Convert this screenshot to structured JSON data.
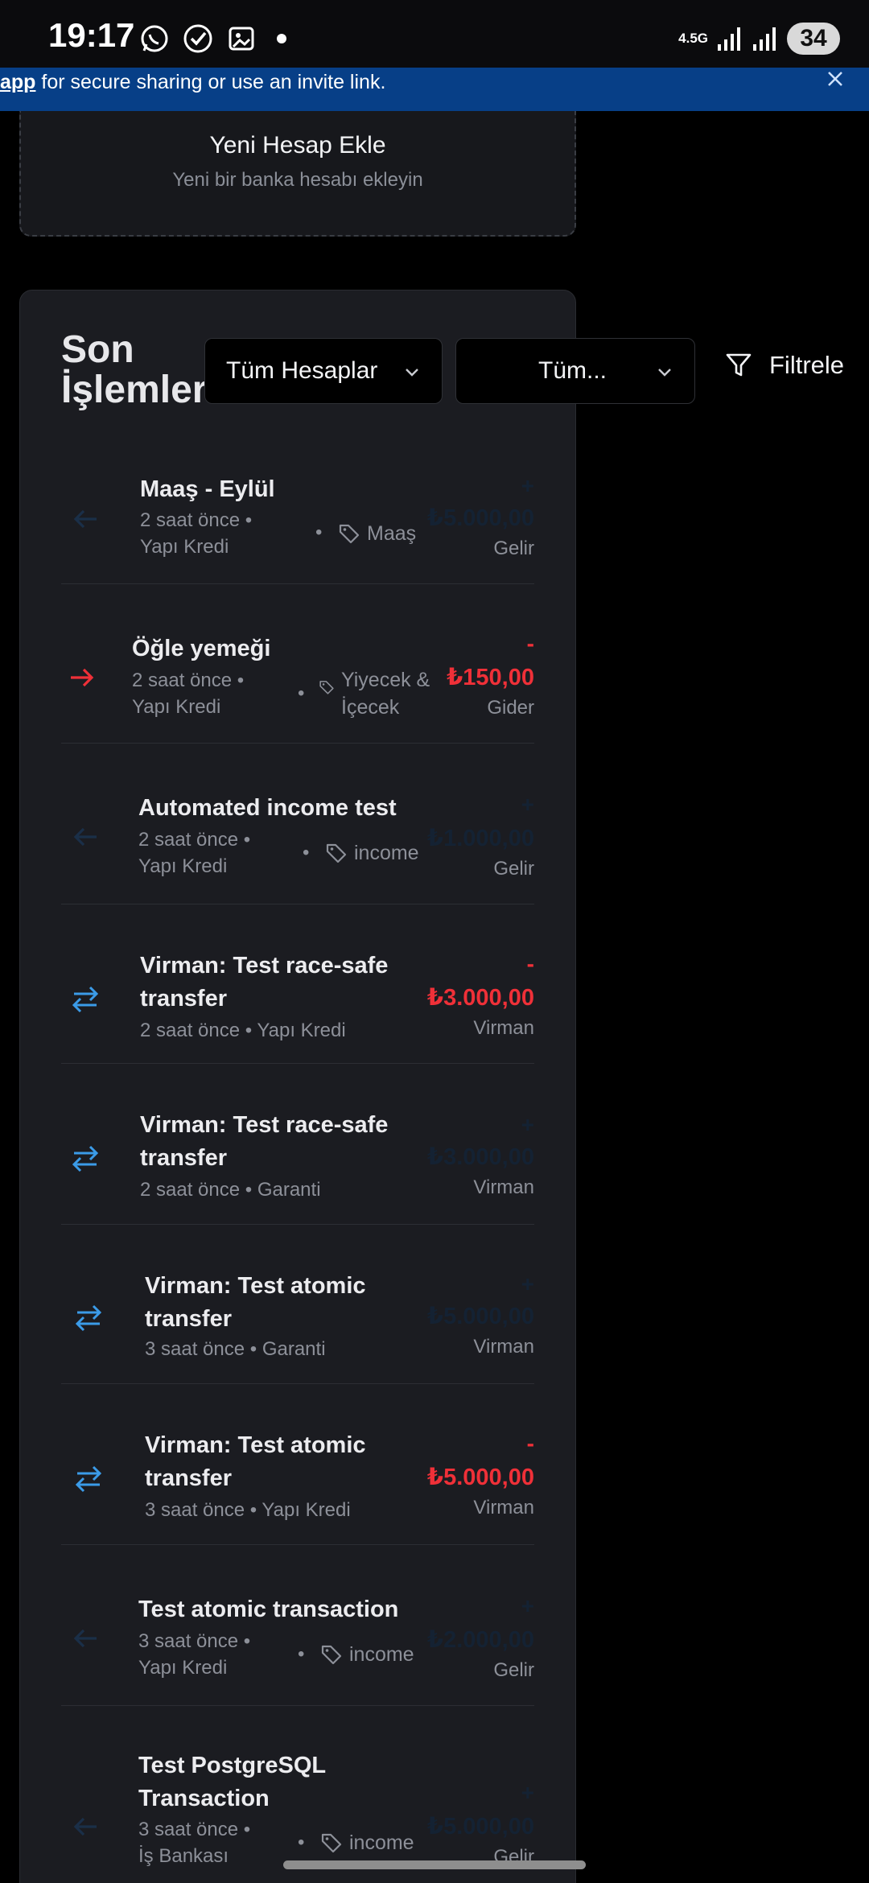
{
  "status_bar": {
    "time": "19:17",
    "network": "4.5G",
    "battery": "34"
  },
  "banner": {
    "link": "app",
    "text": " for secure sharing or use an invite link."
  },
  "add_account": {
    "title": "Yeni Hesap Ekle",
    "subtitle": "Yeni bir banka hesabı ekleyin"
  },
  "transactions": {
    "title": "Son İşlemler",
    "account_filter": "Tüm Hesaplar",
    "type_filter": "Tüm...",
    "filter_button": "Filtrele",
    "colors": {
      "negative": "#ef3038",
      "transfer_icon": "#3b9be8",
      "expense_icon": "#ef3038"
    },
    "rows": [
      {
        "title": "Maaş - Eylül",
        "time": "2 saat önce •",
        "account": "Yapı Kredi",
        "tag": "Maaş",
        "sign": "+",
        "amount": "₺5.000,00",
        "type": "Gelir"
      },
      {
        "title": "Öğle yemeği",
        "time": "2 saat önce •",
        "account": "Yapı Kredi",
        "tag_line1": "Yiyecek &",
        "tag_line2": "İçecek",
        "sign": "-",
        "amount": "₺150,00",
        "type": "Gider"
      },
      {
        "title": "Automated income test",
        "time": "2 saat önce •",
        "account": "Yapı Kredi",
        "tag": "income",
        "sign": "+",
        "amount": "₺1.000,00",
        "type": "Gelir"
      },
      {
        "title_line1": "Virman: Test race-safe",
        "title_line2": "transfer",
        "meta": "2 saat önce • Yapı Kredi",
        "sign": "-",
        "amount": "₺3.000,00",
        "type": "Virman"
      },
      {
        "title_line1": "Virman: Test race-safe",
        "title_line2": "transfer",
        "meta": "2 saat önce • Garanti",
        "sign": "+",
        "amount": "₺3.000,00",
        "type": "Virman"
      },
      {
        "title_line1": "Virman: Test atomic",
        "title_line2": "transfer",
        "meta": "3 saat önce • Garanti",
        "sign": "+",
        "amount": "₺5.000,00",
        "type": "Virman"
      },
      {
        "title_line1": "Virman: Test atomic",
        "title_line2": "transfer",
        "meta": "3 saat önce • Yapı Kredi",
        "sign": "-",
        "amount": "₺5.000,00",
        "type": "Virman"
      },
      {
        "title": "Test atomic transaction",
        "time": "3 saat önce •",
        "account": "Yapı Kredi",
        "tag": "income",
        "sign": "+",
        "amount": "₺2.000,00",
        "type": "Gelir"
      },
      {
        "title_line1": "Test PostgreSQL",
        "title_line2": "Transaction",
        "time": "3 saat önce •",
        "account": "İş Bankası",
        "tag": "income",
        "sign": "+",
        "amount": "₺5.000,00",
        "type": "Gelir"
      }
    ]
  }
}
